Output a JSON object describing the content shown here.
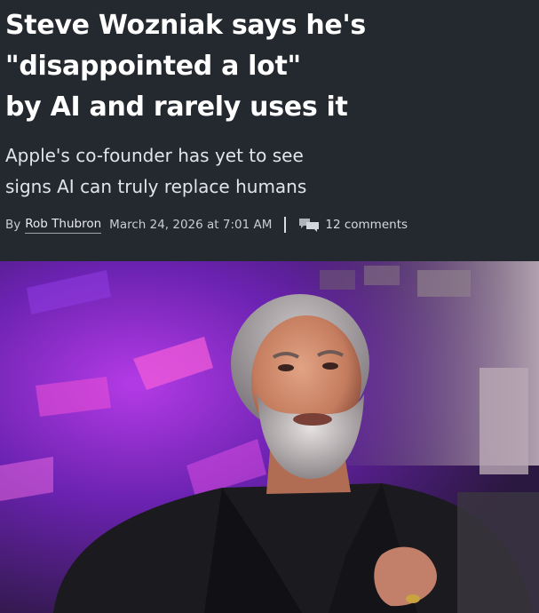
{
  "article": {
    "headline_lines": [
      "Steve Wozniak says he's",
      "\"disappointed a lot\"",
      "by AI and rarely uses it"
    ],
    "dek_lines": [
      "Apple's co-founder has yet to see",
      "signs AI can truly replace humans"
    ],
    "byline": {
      "by": "By",
      "author": "Rob Thubron",
      "date": "March 24, 2026 at 7:01 AM",
      "comments_icon": "comments-icon",
      "comments": "12 comments"
    }
  },
  "hero_image": {
    "subject": "portrait-photo",
    "accent_colors": [
      "#c23cf2",
      "#6a1fb8",
      "#2a1b3d"
    ]
  }
}
